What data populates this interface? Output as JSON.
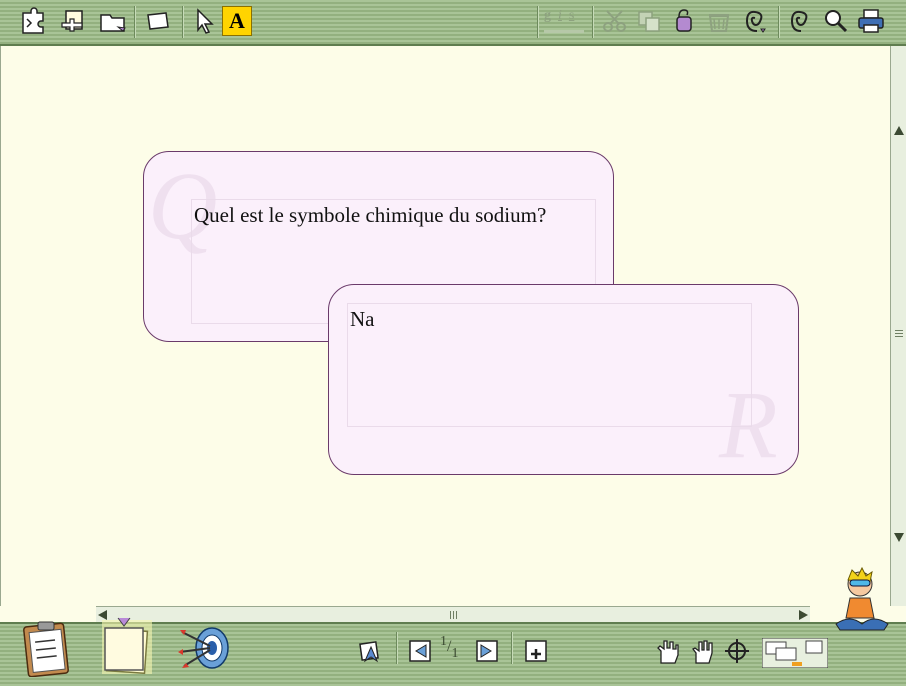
{
  "question": {
    "watermark": "Q",
    "text": "Quel est le symbole chimique du sodium?"
  },
  "answer": {
    "watermark": "R",
    "text": "Na"
  },
  "format": {
    "g": "g",
    "i": "i",
    "s": "s"
  },
  "text_tool": {
    "label": "A"
  },
  "page": {
    "current": "1",
    "total": "1"
  },
  "colors": {
    "toolbar": "#a9c497",
    "canvas": "#fdfde8",
    "card_fill": "#fbf0fb",
    "card_border": "#6a3a6a",
    "highlight": "#ffd400"
  }
}
